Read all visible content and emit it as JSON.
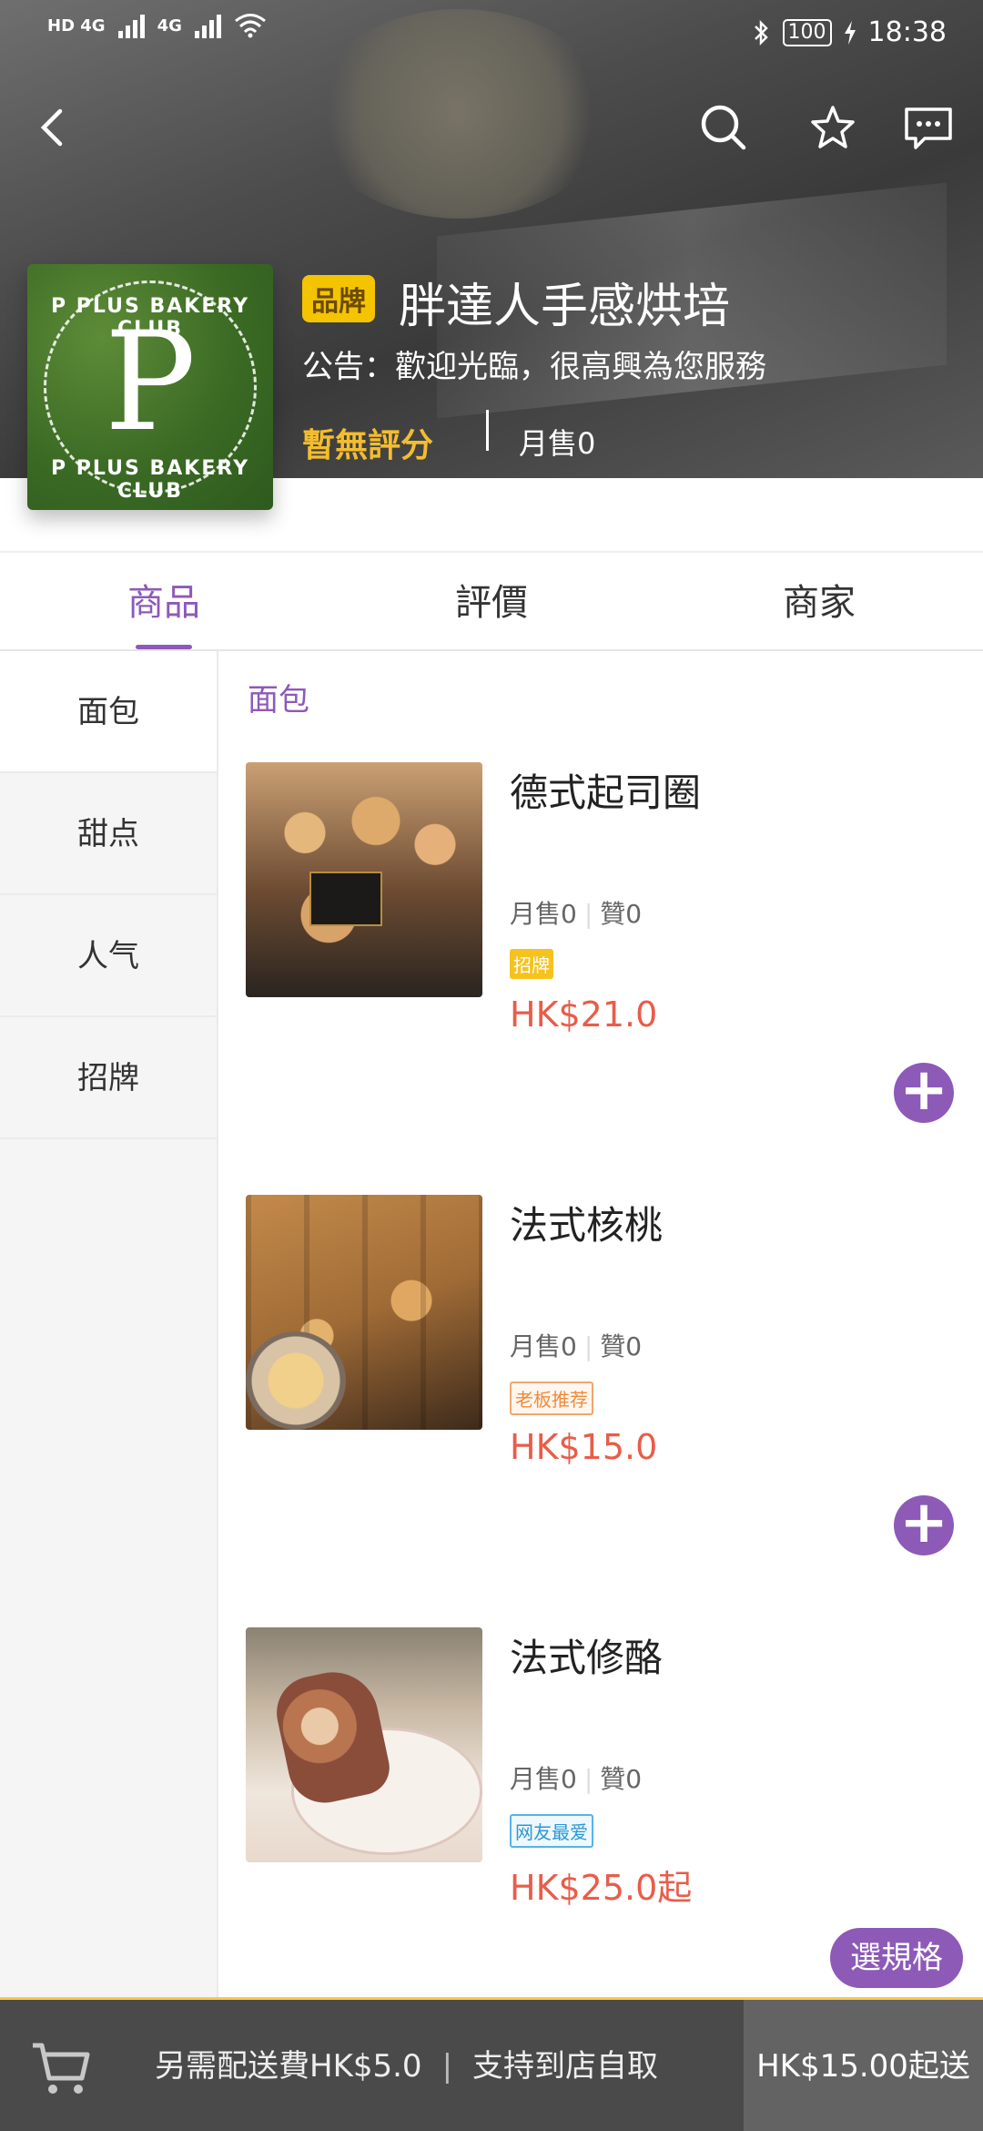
{
  "status_bar": {
    "network_left": "HD 4G",
    "network_right": "4G",
    "battery": "100",
    "time": "18:38"
  },
  "shop": {
    "badge": "品牌",
    "name": "胖達人手感烘培",
    "notice": "公告：歡迎光臨，很高興為您服務",
    "rating": "暫無評分",
    "monthly_sales": "月售0",
    "logo_letter": "P",
    "logo_text_top": "P PLUS BAKERY CLUB",
    "logo_text_bottom": "P PLUS BAKERY CLUB"
  },
  "tabs": [
    {
      "label": "商品"
    },
    {
      "label": "評價"
    },
    {
      "label": "商家"
    }
  ],
  "categories": [
    {
      "label": "面包"
    },
    {
      "label": "甜点"
    },
    {
      "label": "人气"
    },
    {
      "label": "招牌"
    }
  ],
  "section_title": "面包",
  "products": [
    {
      "name": "德式起司圈",
      "monthly": "月售0",
      "likes": "贊0",
      "tag": "招牌",
      "price": "HK$21.0"
    },
    {
      "name": "法式核桃",
      "monthly": "月售0",
      "likes": "贊0",
      "tag": "老板推荐",
      "price": "HK$15.0"
    },
    {
      "name": "法式修酪",
      "monthly": "月售0",
      "likes": "贊0",
      "tag": "网友最爱",
      "price": "HK$25.0起"
    }
  ],
  "spec_button": "選規格",
  "cart_bar": {
    "delivery_fee": "另需配送費HK$5.0",
    "pickup": "支持到店自取",
    "min_order": "HK$15.00起送"
  },
  "colors": {
    "accent": "#8d5ab8",
    "price": "#e85d4a",
    "rating": "#f3bd2d",
    "brand_badge": "#f5c400"
  }
}
